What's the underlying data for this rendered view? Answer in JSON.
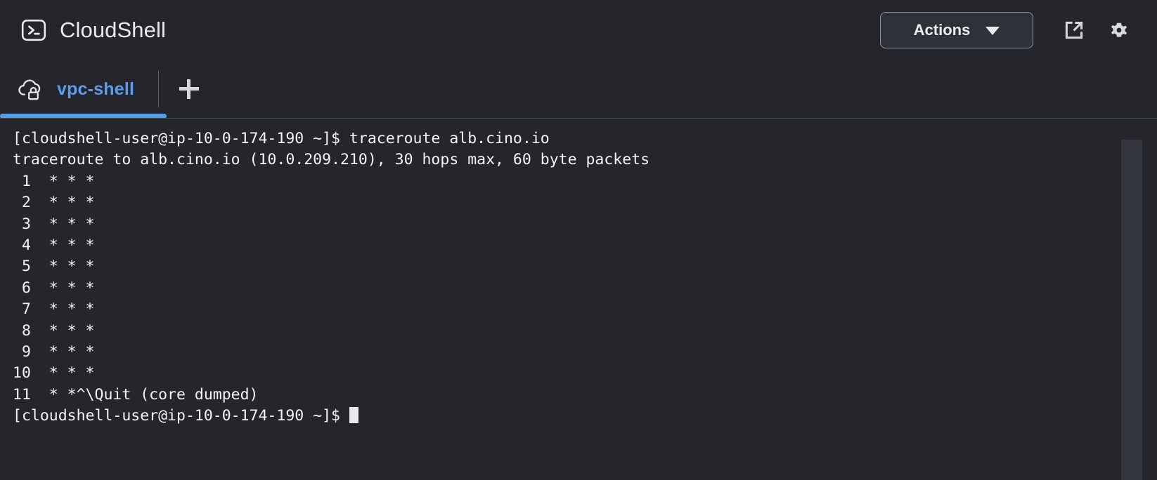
{
  "header": {
    "brand_icon": "cloudshell-terminal-icon",
    "title": "CloudShell",
    "actions_label": "Actions",
    "caret_icon": "chevron-down-icon",
    "external_link_icon": "external-link-icon",
    "settings_icon": "gear-icon"
  },
  "tabs": {
    "items": [
      {
        "label": "vpc-shell",
        "icon": "cloud-lock-icon",
        "active": true
      }
    ],
    "new_tab_icon": "plus-icon",
    "new_tab_label": "+"
  },
  "terminal": {
    "lines": [
      "[cloudshell-user@ip-10-0-174-190 ~]$ traceroute alb.cino.io",
      "traceroute to alb.cino.io (10.0.209.210), 30 hops max, 60 byte packets",
      " 1  * * *",
      " 2  * * *",
      " 3  * * *",
      " 4  * * *",
      " 5  * * *",
      " 6  * * *",
      " 7  * * *",
      " 8  * * *",
      " 9  * * *",
      "10  * * *",
      "11  * *^\\Quit (core dumped)"
    ],
    "prompt": "[cloudshell-user@ip-10-0-174-190 ~]$ ",
    "cursor": "block-cursor"
  },
  "colors": {
    "background": "#24262c",
    "accent_blue": "#539fe5",
    "text": "#f2f4f6",
    "muted_border": "#4c5360"
  }
}
